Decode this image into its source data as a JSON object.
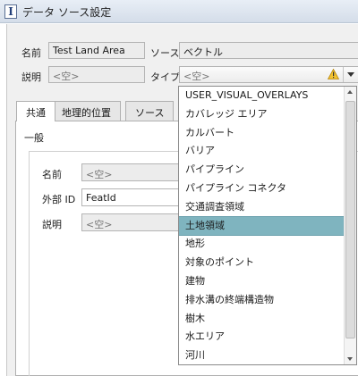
{
  "window": {
    "title": "データ ソース設定"
  },
  "form": {
    "name_label": "名前",
    "name_value": "Test Land Area",
    "source_label": "ソース",
    "source_value": "ベクトル",
    "desc_label": "説明",
    "desc_placeholder": "<空>",
    "type_label": "タイプ",
    "type_value": "<空>"
  },
  "tabs": [
    {
      "label": "共通"
    },
    {
      "label": "地理的位置"
    },
    {
      "label": "ソース"
    }
  ],
  "panel": {
    "group_title": "一般",
    "name_label": "名前",
    "name_placeholder": "<空>",
    "extid_label": "外部 ID",
    "extid_value": "FeatId",
    "desc_label": "説明",
    "desc_placeholder": "<空>"
  },
  "dropdown": {
    "selected": "土地領域",
    "items": [
      "USER_VISUAL_OVERLAYS",
      "カバレッジ エリア",
      "カルバート",
      "バリア",
      "パイプライン",
      "パイプライン コネクタ",
      "交通調査領域",
      "土地領域",
      "地形",
      "対象のポイント",
      "建物",
      "排水溝の終端構造物",
      "樹木",
      "水エリア",
      "河川"
    ]
  },
  "colors": {
    "selection": "#7fb4bf",
    "warning": "#f2c230"
  }
}
